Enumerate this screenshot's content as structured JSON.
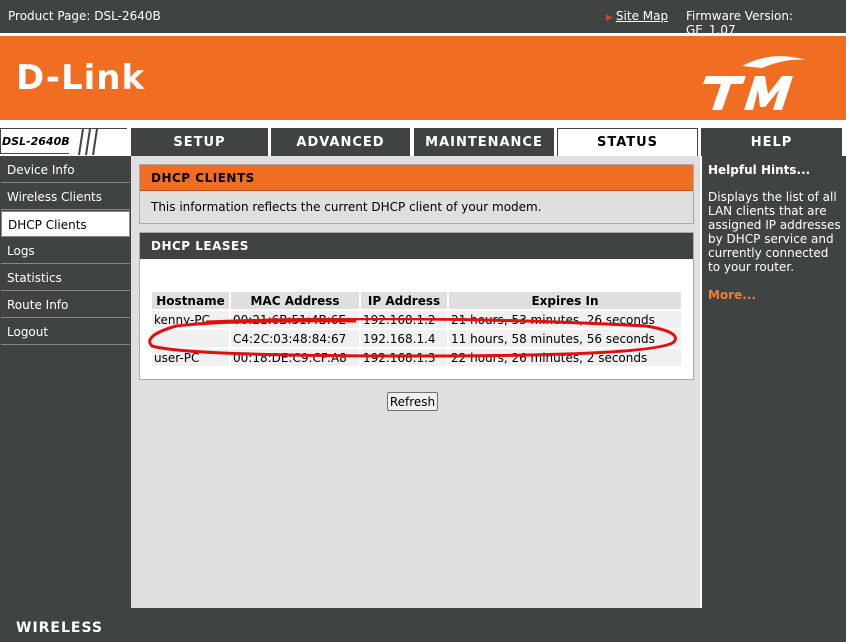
{
  "topbar": {
    "product": "Product Page: DSL-2640B",
    "site_map": "Site Map",
    "firmware": "Firmware Version: GE_1.07"
  },
  "header": {
    "brand": "D-Link",
    "partner_logo": "TM"
  },
  "model": "DSL-2640B",
  "tabs": [
    {
      "label": "SETUP",
      "active": false
    },
    {
      "label": "ADVANCED",
      "active": false
    },
    {
      "label": "MAINTENANCE",
      "active": false
    },
    {
      "label": "STATUS",
      "active": true
    },
    {
      "label": "HELP",
      "active": false
    }
  ],
  "sidebar": {
    "items": [
      {
        "label": "Device Info",
        "active": false
      },
      {
        "label": "Wireless Clients",
        "active": false
      },
      {
        "label": "DHCP Clients",
        "active": true
      },
      {
        "label": "Logs",
        "active": false
      },
      {
        "label": "Statistics",
        "active": false
      },
      {
        "label": "Route Info",
        "active": false
      },
      {
        "label": "Logout",
        "active": false
      }
    ]
  },
  "dhcp_clients": {
    "title": "DHCP CLIENTS",
    "description": "This information reflects the current DHCP client of your modem."
  },
  "dhcp_leases": {
    "title": "DHCP LEASES",
    "columns": [
      "Hostname",
      "MAC Address",
      "IP Address",
      "Expires In"
    ],
    "rows": [
      [
        "kenny-PC",
        "00:21:6B:51:4B:6E",
        "192.168.1.2",
        "21 hours, 53 minutes, 26 seconds"
      ],
      [
        "",
        "C4:2C:03:48:84:67",
        "192.168.1.4",
        "11 hours, 58 minutes, 56 seconds"
      ],
      [
        "user-PC",
        "00:18:DE:C9:CF:A8",
        "192.168.1.3",
        "22 hours, 26 minutes, 2 seconds"
      ]
    ]
  },
  "refresh_label": "Refresh",
  "hints": {
    "title": "Helpful Hints...",
    "text": "Displays the list of all LAN clients that are assigned IP addresses by DHCP service and currently connected to your router.",
    "more": "More..."
  },
  "footer": {
    "label": "WIRELESS"
  },
  "colors": {
    "accent_orange": "#f06d22",
    "dark_gray": "#404343",
    "annotation_red": "#e01010"
  }
}
